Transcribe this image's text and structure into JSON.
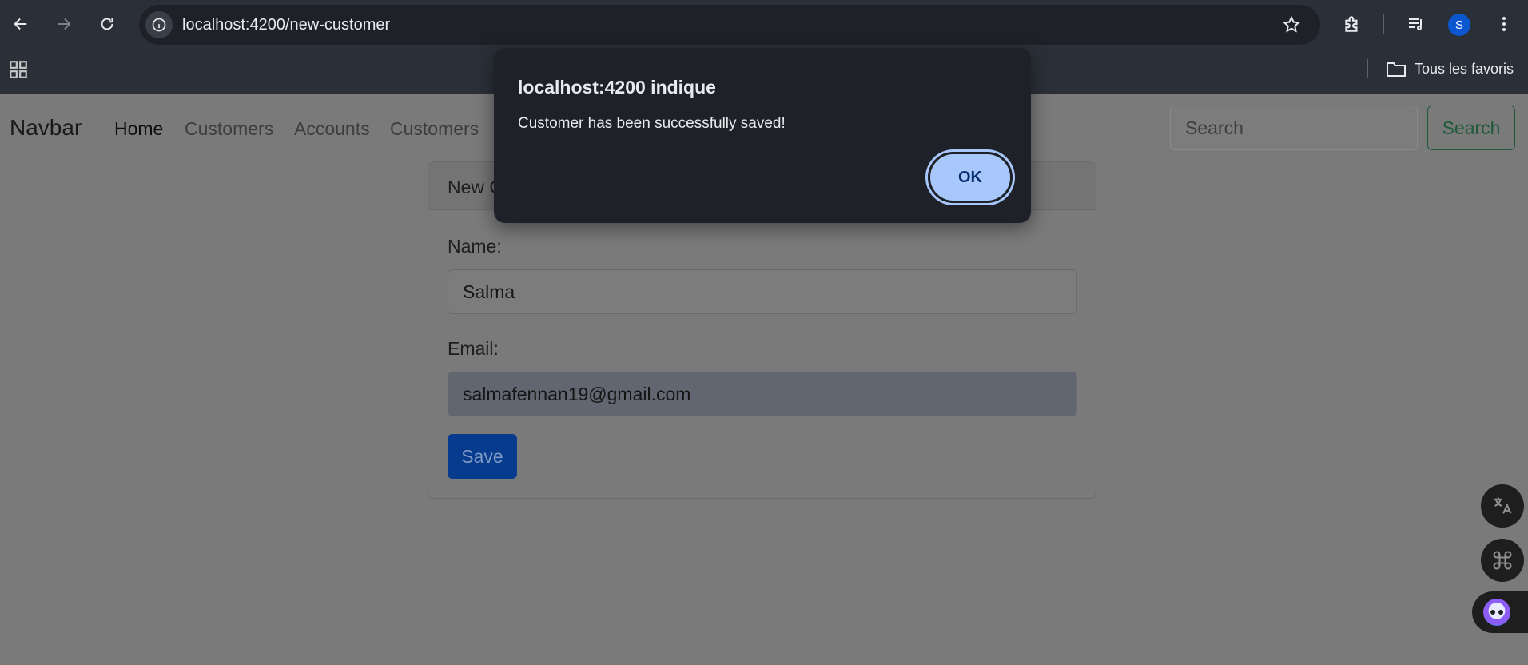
{
  "browser": {
    "url": "localhost:4200/new-customer",
    "bookmarks_folder": "Tous les favoris",
    "profile_initial": "S"
  },
  "navbar": {
    "brand": "Navbar",
    "links": [
      "Home",
      "Customers",
      "Accounts",
      "Customers"
    ],
    "search_placeholder": "Search",
    "search_button": "Search"
  },
  "form": {
    "title": "New Customer",
    "name_label": "Name:",
    "name_value": "Salma",
    "email_label": "Email:",
    "email_value": "salmafennan19@gmail.com",
    "save_label": "Save"
  },
  "dialog": {
    "title": "localhost:4200 indique",
    "message": "Customer has been successfully saved!",
    "ok_label": "OK"
  },
  "colors": {
    "dialog_bg": "#1e2127",
    "ok_button": "#a8c7fa",
    "save_button": "#073b8d",
    "search_button_border": "#1e5a38"
  }
}
